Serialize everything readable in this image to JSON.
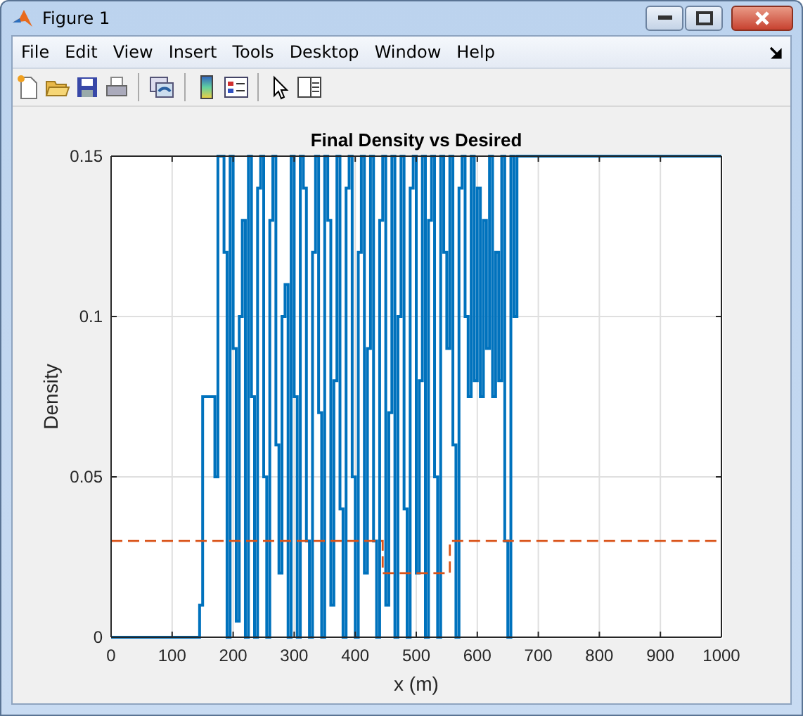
{
  "window": {
    "title": "Figure 1"
  },
  "menu": [
    "File",
    "Edit",
    "View",
    "Insert",
    "Tools",
    "Desktop",
    "Window",
    "Help"
  ],
  "toolbar": [
    {
      "kind": "new"
    },
    {
      "kind": "open"
    },
    {
      "kind": "save"
    },
    {
      "kind": "print"
    },
    {
      "kind": "sep"
    },
    {
      "kind": "link"
    },
    {
      "kind": "sep"
    },
    {
      "kind": "colorbar"
    },
    {
      "kind": "legend"
    },
    {
      "kind": "sep"
    },
    {
      "kind": "pointer"
    },
    {
      "kind": "property"
    }
  ],
  "chart_data": {
    "type": "line",
    "title": "Final Density vs Desired",
    "xlabel": "x (m)",
    "ylabel": "Density",
    "xlim": [
      0,
      1000
    ],
    "ylim": [
      0,
      0.15
    ],
    "grid": true,
    "xticks": [
      0,
      100,
      200,
      300,
      400,
      500,
      600,
      700,
      800,
      900,
      1000
    ],
    "yticks": [
      0,
      0.05,
      0.1,
      0.15
    ],
    "x": [
      0,
      140,
      145,
      150,
      155,
      160,
      165,
      170,
      175,
      180,
      185,
      190,
      195,
      200,
      205,
      210,
      215,
      220,
      225,
      230,
      235,
      240,
      245,
      250,
      255,
      260,
      265,
      270,
      275,
      280,
      285,
      290,
      295,
      300,
      305,
      310,
      315,
      320,
      325,
      330,
      335,
      340,
      345,
      350,
      355,
      360,
      365,
      370,
      375,
      380,
      385,
      390,
      395,
      400,
      405,
      410,
      415,
      420,
      425,
      430,
      435,
      440,
      445,
      450,
      455,
      460,
      465,
      470,
      475,
      480,
      485,
      490,
      495,
      500,
      505,
      510,
      515,
      520,
      525,
      530,
      535,
      540,
      545,
      550,
      555,
      560,
      565,
      570,
      575,
      580,
      585,
      590,
      595,
      600,
      605,
      610,
      615,
      620,
      625,
      630,
      635,
      640,
      645,
      650,
      655,
      660,
      665,
      1000
    ],
    "series": [
      {
        "color": "#0072bd",
        "line_style": "solid",
        "values": [
          0,
          0,
          0.01,
          0.075,
          0.075,
          0.075,
          0.075,
          0.05,
          0.15,
          0.15,
          0.12,
          0,
          0.15,
          0.09,
          0.005,
          0.1,
          0.13,
          0,
          0.15,
          0.075,
          0,
          0.14,
          0.15,
          0.05,
          0,
          0.13,
          0.15,
          0.06,
          0.02,
          0.1,
          0.11,
          0,
          0.15,
          0.075,
          0,
          0.15,
          0.14,
          0.03,
          0,
          0.12,
          0.15,
          0.07,
          0,
          0.15,
          0.13,
          0.01,
          0.08,
          0.15,
          0.04,
          0,
          0.14,
          0.15,
          0.05,
          0,
          0.12,
          0.15,
          0.02,
          0.09,
          0.15,
          0.03,
          0,
          0.13,
          0.15,
          0.01,
          0.07,
          0.15,
          0,
          0.1,
          0.15,
          0.04,
          0,
          0.14,
          0.15,
          0.02,
          0.08,
          0.15,
          0,
          0.13,
          0.15,
          0.05,
          0,
          0.15,
          0.12,
          0.09,
          0.15,
          0.06,
          0,
          0.14,
          0.15,
          0.1,
          0.075,
          0.15,
          0.08,
          0.14,
          0.075,
          0.13,
          0.09,
          0.15,
          0.075,
          0.12,
          0.08,
          0.15,
          0.03,
          0,
          0.15,
          0.1,
          0.15,
          0.15
        ]
      },
      {
        "color": "#d95319",
        "line_style": "dashed",
        "values": [
          0.03,
          0.03,
          0.03,
          0.03,
          0.03,
          0.03,
          0.03,
          0.03,
          0.03,
          0.03,
          0.03,
          0.03,
          0.03,
          0.03,
          0.03,
          0.03,
          0.03,
          0.03,
          0.03,
          0.03,
          0.03,
          0.03,
          0.03,
          0.03,
          0.03,
          0.03,
          0.03,
          0.03,
          0.03,
          0.03,
          0.03,
          0.03,
          0.03,
          0.03,
          0.03,
          0.03,
          0.03,
          0.03,
          0.03,
          0.03,
          0.03,
          0.03,
          0.03,
          0.03,
          0.03,
          0.03,
          0.03,
          0.03,
          0.03,
          0.03,
          0.03,
          0.03,
          0.03,
          0.03,
          0.03,
          0.03,
          0.03,
          0.03,
          0.03,
          0.03,
          0.03,
          0.03,
          0.02,
          0.02,
          0.02,
          0.02,
          0.02,
          0.02,
          0.02,
          0.02,
          0.02,
          0.02,
          0.02,
          0.02,
          0.02,
          0.02,
          0.02,
          0.02,
          0.02,
          0.02,
          0.02,
          0.02,
          0.02,
          0.02,
          0.03,
          0.03,
          0.03,
          0.03,
          0.03,
          0.03,
          0.03,
          0.03,
          0.03,
          0.03,
          0.03,
          0.03,
          0.03,
          0.03,
          0.03,
          0.03,
          0.03,
          0.03,
          0.03,
          0.03,
          0.03,
          0.03,
          0.03,
          0.03
        ]
      }
    ]
  }
}
